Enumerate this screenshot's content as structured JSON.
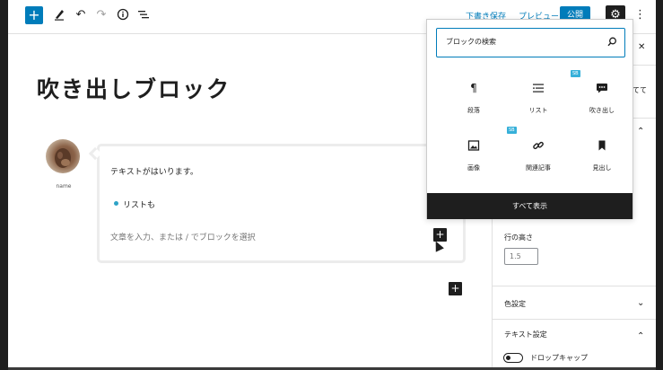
{
  "toolbar": {
    "add_icon": "plus-icon",
    "tools_icon": "pen-icon",
    "undo_icon": "undo-icon",
    "redo_icon": "redo-icon",
    "details_icon": "info-icon",
    "outline_icon": "list-view-icon",
    "save_draft_label": "下書き保存",
    "preview_label": "プレビュー",
    "publish_label": "公開",
    "settings_icon": "gear-icon",
    "more_icon": "more-vertical-icon"
  },
  "editor": {
    "post_title": "吹き出しブロック",
    "balloon": {
      "name": "name",
      "text": "テキストがはいります。",
      "list_item": "リストも",
      "placeholder": "文章を入力、または / でブロックを選択"
    }
  },
  "sidebar": {
    "close_icon": "close-icon",
    "text_fragment": "てて",
    "line_height_label": "行の高さ",
    "line_height_value": "1.5",
    "color_section_label": "色設定",
    "text_section_label": "テキスト設定",
    "drop_cap_label": "ドロップキャップ"
  },
  "inserter": {
    "search_placeholder": "ブロックの検索",
    "search_icon": "search-icon",
    "items": [
      {
        "label": "段落",
        "icon": "pilcrow-icon"
      },
      {
        "label": "リスト",
        "icon": "list-icon"
      },
      {
        "label": "吹き出し",
        "icon": "speech-bubble-icon",
        "badge": "SB"
      },
      {
        "label": "画像",
        "icon": "image-icon"
      },
      {
        "label": "関連記事",
        "icon": "link-icon",
        "badge": "SB"
      },
      {
        "label": "見出し",
        "icon": "bookmark-icon"
      }
    ],
    "browse_all_label": "すべて表示"
  },
  "colors": {
    "accent": "#007cba",
    "badge": "#36b0d9",
    "dark": "#1e1e1e"
  }
}
